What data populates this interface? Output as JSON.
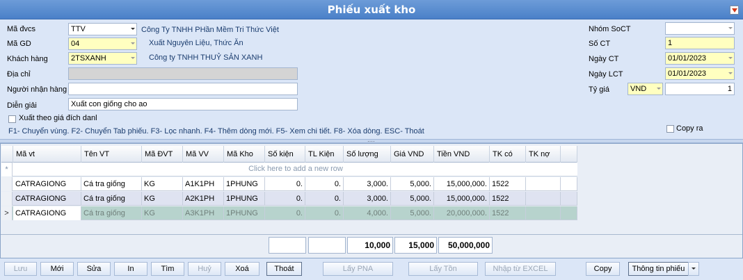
{
  "window": {
    "title": "Phiếu xuất kho"
  },
  "form": {
    "ma_dvcs": {
      "label": "Mã đvcs",
      "value": "TTV",
      "info": "Công Ty TNHH PHần Mềm Tri Thức Việt"
    },
    "ma_gd": {
      "label": "Mã GD",
      "value": "04",
      "info": "Xuất Nguyên Liệu, Thức Ăn"
    },
    "khach_hang": {
      "label": "Khách hàng",
      "value": "2TSXANH",
      "info": "Công ty TNHH THUỶ SẢN XANH"
    },
    "dia_chi": {
      "label": "Địa chỉ",
      "value": ""
    },
    "nguoi_nhan": {
      "label": "Người nhận hàng",
      "value": ""
    },
    "dien_giai": {
      "label": "Diễn giải",
      "value": "Xuất con giống cho ao"
    },
    "xuat_theo_gia": {
      "label": "Xuất theo giá đích danl",
      "checked": false
    },
    "hotkeys": "F1- Chuyển vùng. F2- Chuyển Tab phiếu. F3- Lọc nhanh. F4- Thêm dòng mới. F5- Xem chi tiết. F8- Xóa dòng. ESC- Thoát",
    "nhom_soct": {
      "label": "Nhóm SoCT",
      "value": ""
    },
    "so_ct": {
      "label": "Số CT",
      "value": "1"
    },
    "ngay_ct": {
      "label": "Ngày CT",
      "value": "01/01/2023"
    },
    "ngay_lct": {
      "label": "Ngày LCT",
      "value": "01/01/2023"
    },
    "ty_gia": {
      "label": "Tỷ giá",
      "currency": "VND",
      "value": "1"
    },
    "copy_ra": {
      "label": "Copy ra",
      "checked": false
    }
  },
  "grid": {
    "columns": [
      "Mã vt",
      "Tên VT",
      "Mã ĐVT",
      "Mã VV",
      "Mã Kho",
      "Số kiện",
      "TL Kiện",
      "Số lượng",
      "Giá VND",
      "Tiền VND",
      "TK có",
      "TK nợ"
    ],
    "new_row_text": "Click here to add a new row",
    "new_row_icon": "asterisk-icon",
    "rows": [
      {
        "ma_vt": "CATRAGIONG",
        "ten_vt": "Cá tra giống",
        "ma_dvt": "KG",
        "ma_vv": "A1K1PH",
        "ma_kho": "1PHUNG",
        "so_kien": "0.",
        "tl_kien": "0.",
        "so_luong": "3,000.",
        "gia": "5,000.",
        "tien": "15,000,000.",
        "tk_co": "1522",
        "tk_no": ""
      },
      {
        "ma_vt": "CATRAGIONG",
        "ten_vt": "Cá tra giống",
        "ma_dvt": "KG",
        "ma_vv": "A2K1PH",
        "ma_kho": "1PHUNG",
        "so_kien": "0.",
        "tl_kien": "0.",
        "so_luong": "3,000.",
        "gia": "5,000.",
        "tien": "15,000,000.",
        "tk_co": "1522",
        "tk_no": ""
      },
      {
        "ma_vt": "CATRAGIONG",
        "ten_vt": "Cá tra giống",
        "ma_dvt": "KG",
        "ma_vv": "A3K1PH",
        "ma_kho": "1PHUNG",
        "so_kien": "0.",
        "tl_kien": "0.",
        "so_luong": "4,000.",
        "gia": "5,000.",
        "tien": "20,000,000.",
        "tk_co": "1522",
        "tk_no": ""
      }
    ],
    "current_row_marker": ">",
    "totals": {
      "so_kien": "",
      "tl_kien": "",
      "so_luong": "10,000",
      "gia": "15,000",
      "tien": "50,000,000"
    }
  },
  "buttons": {
    "luu": "Lưu",
    "moi": "Mới",
    "sua": "Sửa",
    "in": "In",
    "tim": "Tìm",
    "huy": "Huỷ",
    "xoa": "Xoá",
    "thoat": "Thoát",
    "lay_pna": "Lấy PNA",
    "lay_ton": "Lấy Tồn",
    "nhap_excel": "Nhập từ EXCEL",
    "copy": "Copy",
    "thong_tin": "Thông tin phiếu"
  },
  "colors": {
    "title_bar": "#4a80c8",
    "required_field": "#ffffc0",
    "selected_row": "#b7d3cd",
    "alt_row": "#dfe3f1"
  }
}
